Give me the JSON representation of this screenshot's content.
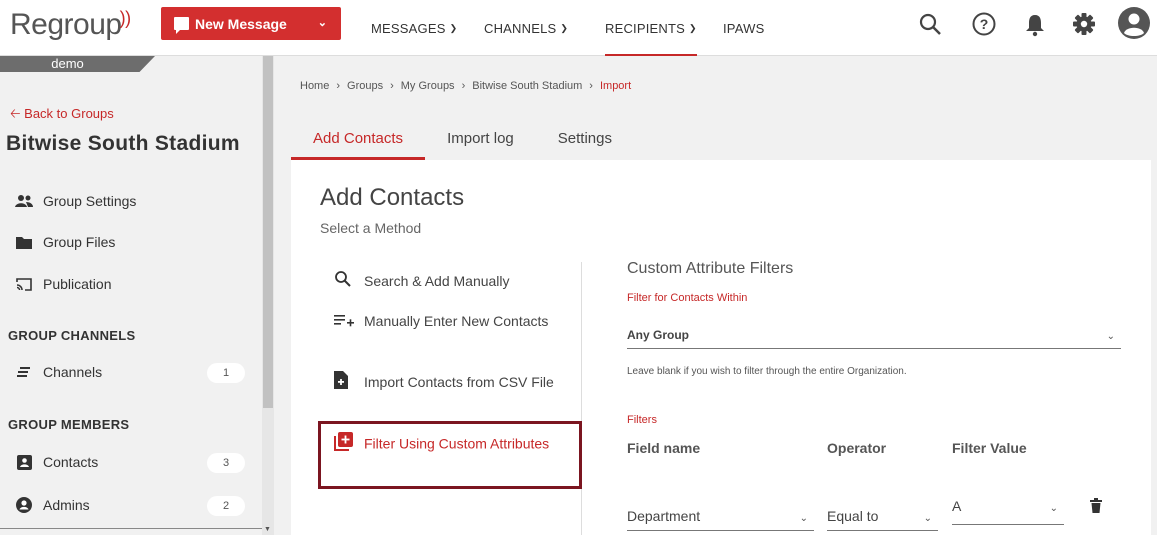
{
  "brand": {
    "logo_text": "Regroup",
    "accent": "#c62828"
  },
  "topbar": {
    "new_message": "New Message",
    "nav": [
      {
        "label": "MESSAGES"
      },
      {
        "label": "CHANNELS"
      },
      {
        "label": "RECIPIENTS"
      },
      {
        "label": "IPAWS"
      }
    ],
    "icons": [
      "search-icon",
      "help-icon",
      "bell-icon",
      "gear-icon",
      "avatar-icon"
    ]
  },
  "sidebar": {
    "org_tag": "demo",
    "back_label": "Back to Groups",
    "group_name": "Bitwise South Stadium",
    "items": [
      {
        "label": "Group Settings",
        "icon": "people-icon"
      },
      {
        "label": "Group Files",
        "icon": "folder-icon"
      },
      {
        "label": "Publication",
        "icon": "cast-icon"
      }
    ],
    "channels_heading": "GROUP CHANNELS",
    "channels": [
      {
        "label": "Channels",
        "count": "1",
        "icon": "channels-icon"
      }
    ],
    "members_heading": "GROUP MEMBERS",
    "members": [
      {
        "label": "Contacts",
        "count": "3",
        "icon": "contact-card-icon"
      },
      {
        "label": "Admins",
        "count": "2",
        "icon": "admin-icon"
      }
    ]
  },
  "breadcrumb": [
    "Home",
    "Groups",
    "My Groups",
    "Bitwise South Stadium",
    "Import"
  ],
  "tabs": [
    {
      "label": "Add Contacts"
    },
    {
      "label": "Import log"
    },
    {
      "label": "Settings"
    }
  ],
  "card": {
    "title": "Add Contacts",
    "subtitle": "Select a Method",
    "methods": [
      {
        "label": "Search & Add Manually",
        "icon": "search-icon"
      },
      {
        "label": "Manually Enter New Contacts",
        "icon": "list-add-icon"
      },
      {
        "label": "Import Contacts from CSV File",
        "icon": "file-add-icon"
      },
      {
        "label": "Filter Using Custom Attributes",
        "icon": "filter-add-icon"
      }
    ],
    "filters": {
      "title": "Custom Attribute Filters",
      "within_label": "Filter for Contacts Within",
      "within_value": "Any Group",
      "hint": "Leave blank if you wish to filter through the entire Organization.",
      "filters_label": "Filters",
      "col_field": "Field name",
      "col_operator": "Operator",
      "col_value": "Filter Value",
      "row": {
        "field": "Department",
        "operator": "Equal to",
        "value": "A"
      }
    }
  }
}
